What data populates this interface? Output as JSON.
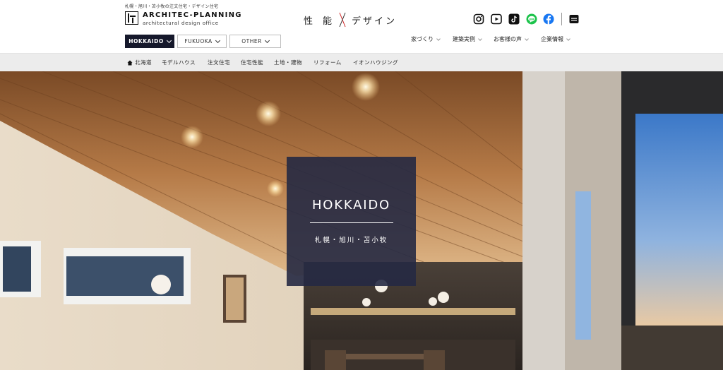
{
  "brand": {
    "tagline": "札幌・旭川・苫小牧の注文住宅・デザイン住宅",
    "name": "ARCHITEC-PLANNING",
    "subtitle": "architectural design office"
  },
  "header": {
    "center_title_left": "性能",
    "center_title_right": "デザイン"
  },
  "regions": [
    {
      "label": "HOKKAIDO",
      "active": true
    },
    {
      "label": "FUKUOKA",
      "active": false
    },
    {
      "label": "OTHER",
      "active": false
    }
  ],
  "social_icons": [
    "instagram-icon",
    "youtube-icon",
    "tiktok-icon",
    "line-icon",
    "facebook-icon",
    "menu-card-icon"
  ],
  "nav_right": [
    {
      "label": "家づくり"
    },
    {
      "label": "建築実例"
    },
    {
      "label": "お客様の声"
    },
    {
      "label": "企業情報"
    }
  ],
  "subnav": [
    {
      "label": "北海道"
    },
    {
      "label": "モデルハウス"
    },
    {
      "label": "注文住宅"
    },
    {
      "label": "住宅性能"
    },
    {
      "label": "土地・建物"
    },
    {
      "label": "リフォーム"
    },
    {
      "label": "イオンハウジング"
    }
  ],
  "hero": {
    "title": "HOKKAIDO",
    "subtitle": "札幌・旭川・苫小牧"
  },
  "colors": {
    "active_region_bg": "#15182b",
    "card_bg": "#252942",
    "subnav_bg": "#ececec"
  }
}
